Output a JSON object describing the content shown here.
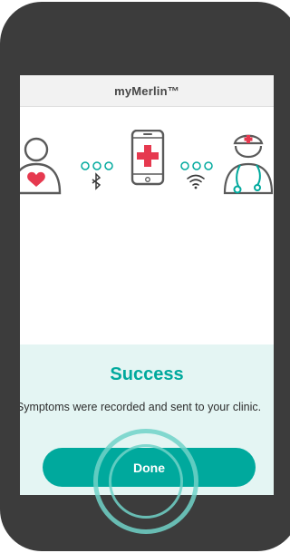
{
  "app": {
    "title": "myMerlin™"
  },
  "icons": {
    "patient": "patient-heart-icon",
    "bluetooth": "bluetooth-icon",
    "phone": "phone-medical-cross-icon",
    "wifi": "wifi-icon",
    "doctor": "doctor-icon"
  },
  "result": {
    "heading": "Success",
    "message": "Symptoms were recorded and sent to your clinic."
  },
  "actions": {
    "done_label": "Done"
  },
  "colors": {
    "accent": "#00a99d",
    "heart": "#e6394f",
    "panel": "#e4f5f3",
    "device_frame": "#3c3c3c"
  }
}
